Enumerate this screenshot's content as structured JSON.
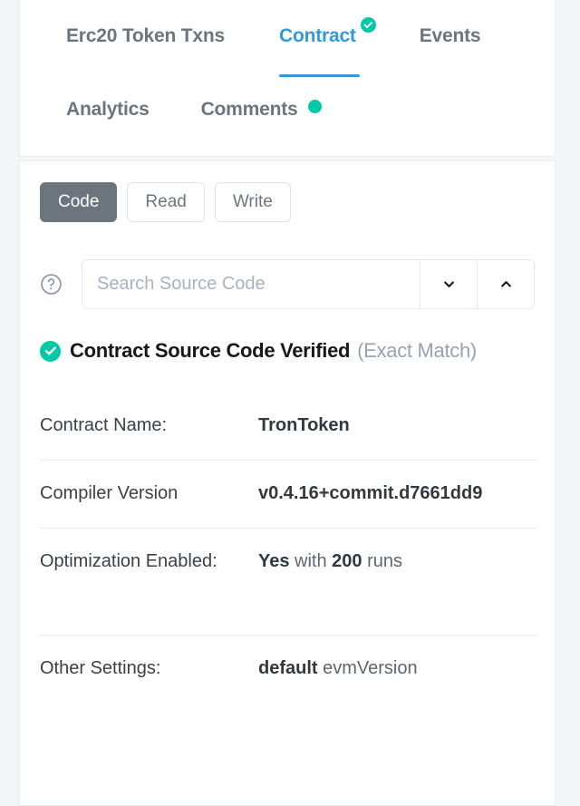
{
  "tabs": {
    "row1": [
      {
        "label": "Erc20 Token Txns",
        "active": false,
        "badge": "none"
      },
      {
        "label": "Contract",
        "active": true,
        "badge": "check-circle-icon"
      },
      {
        "label": "Events",
        "active": false,
        "badge": "none"
      }
    ],
    "row2": [
      {
        "label": "Analytics",
        "active": false,
        "badge": "none"
      },
      {
        "label": "Comments",
        "active": false,
        "badge": "dot-icon"
      }
    ]
  },
  "toolbar": {
    "code_label": "Code",
    "read_label": "Read",
    "write_label": "Write"
  },
  "search": {
    "help_icon": "question-circle-icon",
    "placeholder": "Search Source Code",
    "value": "",
    "next_icon": "chevron-down-icon",
    "prev_icon": "chevron-up-icon"
  },
  "verified": {
    "icon": "check-circle-icon",
    "title": "Contract Source Code Verified",
    "subtitle": "(Exact Match)"
  },
  "details": [
    {
      "label": "Contract Name:",
      "value_bold": "TronToken",
      "value_rest": ""
    },
    {
      "label": "Compiler Version",
      "value_bold": "v0.4.16+commit.d7661dd9",
      "value_rest": ""
    },
    {
      "label": "Optimization Enabled:",
      "value_bold": "Yes",
      "value_mid": " with ",
      "value_bold2": "200",
      "value_rest": " runs"
    },
    {
      "label": "Other Settings:",
      "value_bold": "default",
      "value_rest": " evmVersion"
    }
  ],
  "colors": {
    "accent_blue": "#3498db",
    "verified_teal": "#00c9a7",
    "button_gray": "#6c757d",
    "page_bg": "#f4f5f7"
  }
}
